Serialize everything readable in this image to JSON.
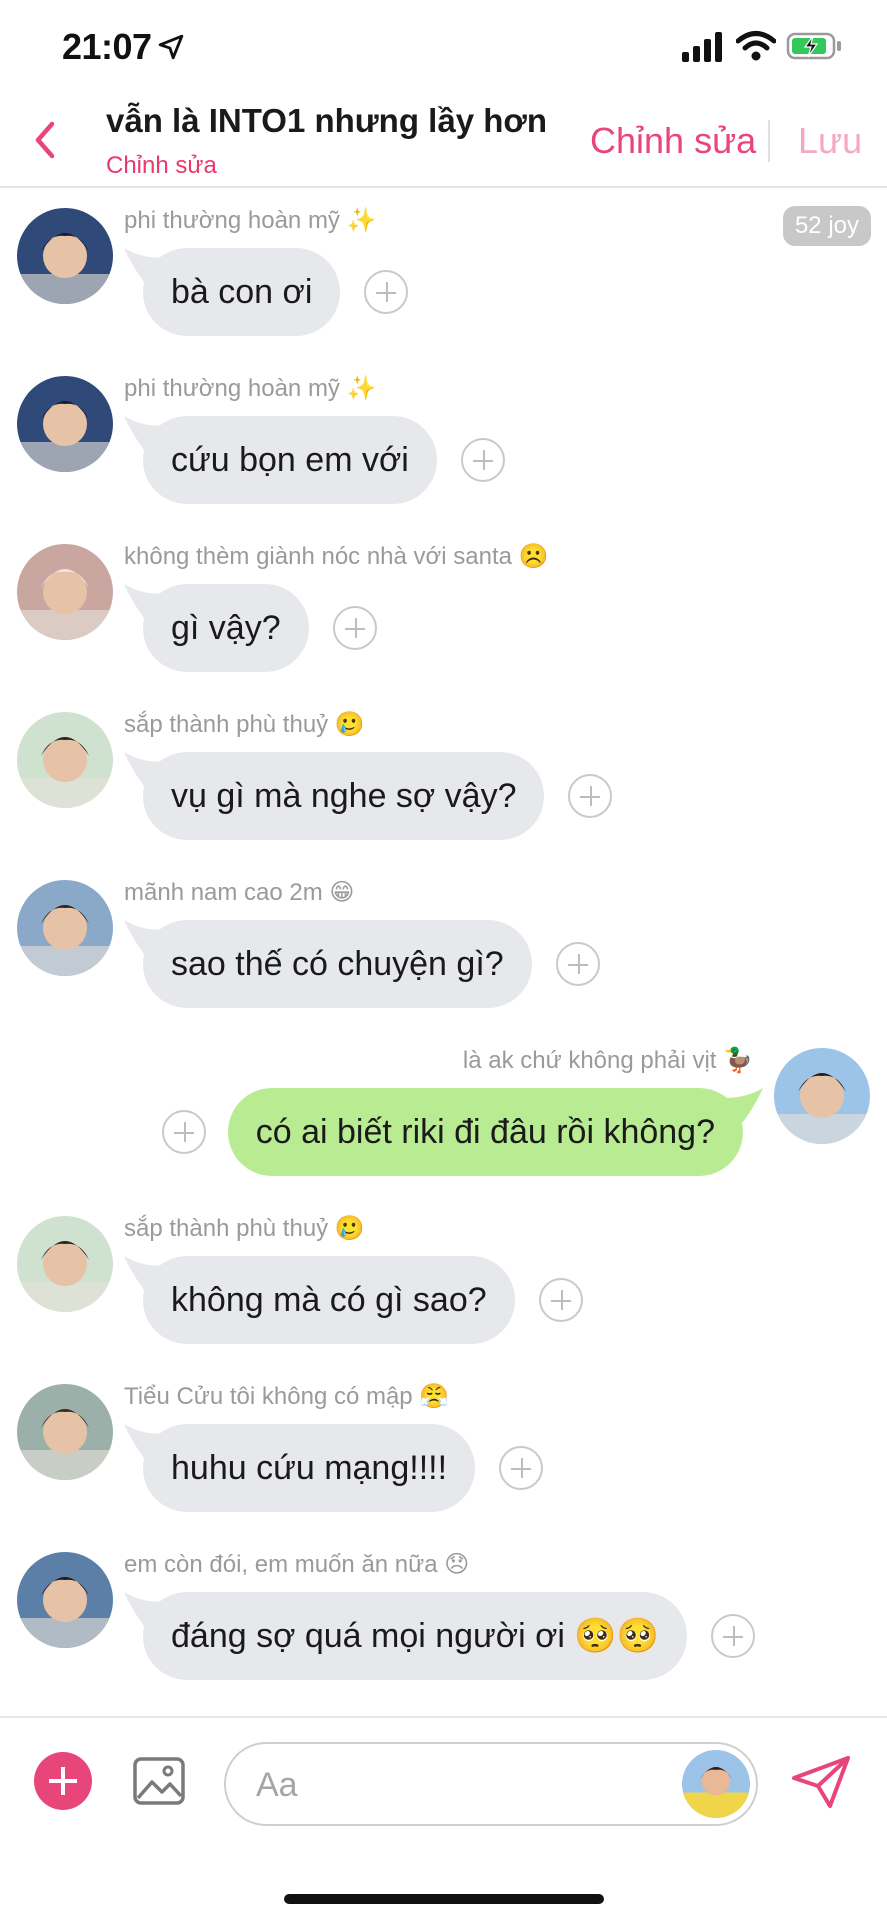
{
  "status_bar": {
    "time": "21:07"
  },
  "header": {
    "title": "vẫn là INTO1 nhưng lầy hơn",
    "subtitle": "Chỉnh sửa",
    "edit_label": "Chỉnh sửa",
    "save_label": "Lưu"
  },
  "badge": "52 joy",
  "messages": [
    {
      "sender": "phi thường hoàn mỹ ✨",
      "text": "bà con ơi",
      "mine": false
    },
    {
      "sender": "phi thường hoàn mỹ ✨",
      "text": "cứu bọn em với",
      "mine": false
    },
    {
      "sender": "không thèm giành nóc nhà với santa ☹️",
      "text": "gì vậy?",
      "mine": false
    },
    {
      "sender": "sắp thành phù thuỷ 🥲",
      "text": "vụ gì mà nghe sợ vậy?",
      "mine": false
    },
    {
      "sender": "mãnh nam cao 2m 😁",
      "text": "sao thế có chuyện gì?",
      "mine": false
    },
    {
      "sender": "là ak chứ không phải vịt 🦆",
      "text": "có ai biết riki đi đâu rồi không?",
      "mine": true
    },
    {
      "sender": "sắp thành phù thuỷ 🥲",
      "text": "không mà có gì sao?",
      "mine": false
    },
    {
      "sender": "Tiểu Cửu tôi không có mập 😤",
      "text": "huhu cứu mạng!!!!",
      "mine": false
    },
    {
      "sender": "em còn đói, em muốn ăn nữa 😞",
      "text": "đáng sợ quá mọi người ơi 🥺🥺",
      "mine": false
    }
  ],
  "composer": {
    "placeholder": "Aa"
  },
  "colors": {
    "accent": "#e8457a",
    "own_bubble": "#b9ec92",
    "other_bubble": "#e7e8ec"
  },
  "icons": [
    "location-arrow-icon",
    "signal-icon",
    "wifi-icon",
    "battery-icon",
    "back-chevron-icon",
    "add-reaction-icon",
    "plus-icon",
    "image-icon",
    "send-icon"
  ]
}
